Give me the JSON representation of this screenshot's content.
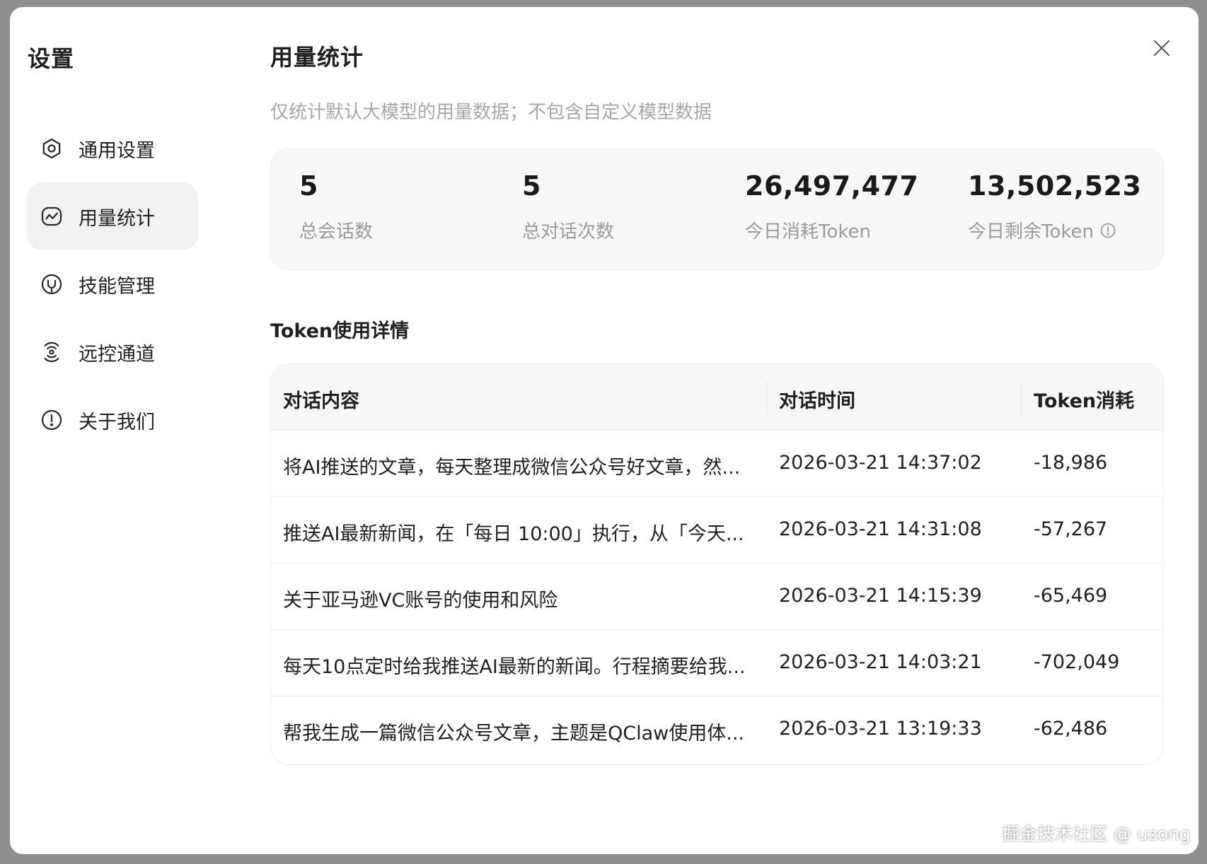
{
  "sidebar": {
    "title": "设置",
    "items": [
      {
        "label": "通用设置",
        "icon": "gear-icon"
      },
      {
        "label": "用量统计",
        "icon": "chart-line-icon",
        "active": true
      },
      {
        "label": "技能管理",
        "icon": "skill-icon"
      },
      {
        "label": "远控通道",
        "icon": "signal-icon"
      },
      {
        "label": "关于我们",
        "icon": "info-icon"
      }
    ]
  },
  "main": {
    "title": "用量统计",
    "subtitle": "仅统计默认大模型的用量数据；不包含自定义模型数据",
    "stats": [
      {
        "value": "5",
        "label": "总会话数"
      },
      {
        "value": "5",
        "label": "总对话次数"
      },
      {
        "value": "26,497,477",
        "label": "今日消耗Token"
      },
      {
        "value": "13,502,523",
        "label": "今日剩余Token"
      }
    ],
    "section_title": "Token使用详情",
    "table": {
      "headers": [
        "对话内容",
        "对话时间",
        "Token消耗"
      ],
      "rows": [
        [
          "将AI推送的文章，每天整理成微信公众号好文章，然...",
          "2026-03-21 14:37:02",
          "-18,986"
        ],
        [
          "推送AI最新新闻，在「每日 10:00」执行，从「今天...",
          "2026-03-21 14:31:08",
          "-57,267"
        ],
        [
          "关于亚马逊VC账号的使用和风险",
          "2026-03-21 14:15:39",
          "-65,469"
        ],
        [
          "每天10点定时给我推送AI最新的新闻。行程摘要给我...",
          "2026-03-21 14:03:21",
          "-702,049"
        ],
        [
          "帮我生成一篇微信公众号文章，主题是QClaw使用体...",
          "2026-03-21 13:19:33",
          "-62,486"
        ]
      ]
    }
  },
  "watermark": "掘金技术社区 @ uzong"
}
